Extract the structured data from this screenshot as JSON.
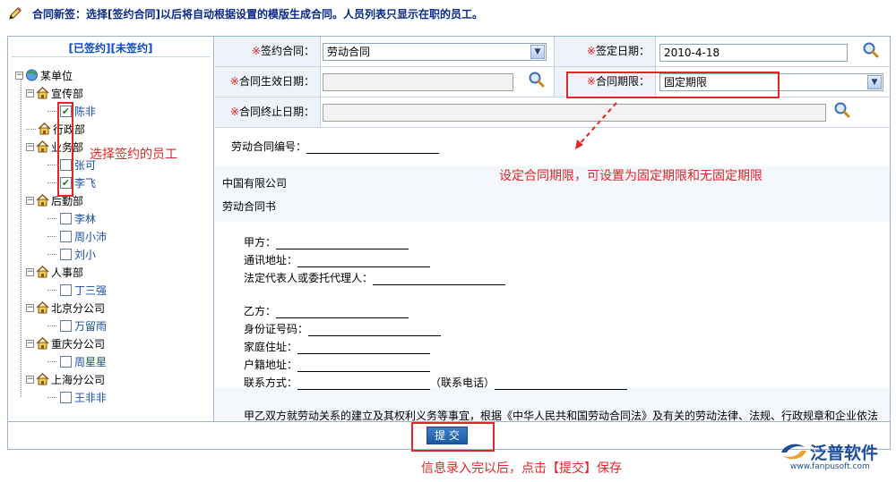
{
  "header": {
    "notice": "合同新签：选择[签约合同]以后将自动根据设置的模版生成合同。人员列表只显示在职的员工。",
    "pen_icon": "pencil-icon"
  },
  "tree": {
    "tab_signed": "[已签约]",
    "tab_unsigned": "[未签约]",
    "root": "某单位",
    "nodes": [
      {
        "dept": "宣传部",
        "employees": [
          {
            "name": "陈非",
            "checked": true
          }
        ]
      },
      {
        "dept": "行政部",
        "employees": []
      },
      {
        "dept": "业务部",
        "employees": [
          {
            "name": "张可",
            "checked": false
          },
          {
            "name": "李飞",
            "checked": true
          }
        ]
      },
      {
        "dept": "后勤部",
        "employees": [
          {
            "name": "李林",
            "checked": false
          },
          {
            "name": "周小沛",
            "checked": false
          },
          {
            "name": "刘小",
            "checked": false
          }
        ]
      },
      {
        "dept": "人事部",
        "employees": [
          {
            "name": "丁三强",
            "checked": false
          }
        ]
      },
      {
        "dept": "北京分公司",
        "employees": [
          {
            "name": "万留雨",
            "checked": false
          }
        ]
      },
      {
        "dept": "重庆分公司",
        "employees": [
          {
            "name": "周星星",
            "checked": false
          }
        ]
      },
      {
        "dept": "上海分公司",
        "employees": [
          {
            "name": "王非非",
            "checked": false
          }
        ]
      }
    ]
  },
  "form": {
    "contract_label": "签约合同：",
    "contract_value": "劳动合同",
    "sign_date_label": "签定日期：",
    "sign_date_value": "2010-4-18",
    "effective_date_label": "合同生效日期：",
    "effective_date_value": "",
    "term_label": "合同期限：",
    "term_value": "固定期限",
    "end_date_label": "合同终止日期：",
    "end_date_value": "",
    "required_mark": "※"
  },
  "document": {
    "contract_no": "劳动合同编号：",
    "company": "中国有限公司",
    "title": "劳动合同书",
    "party_a": "甲方：",
    "address": "通讯地址：",
    "legal_rep": "法定代表人或委托代理人：",
    "party_b": "乙方：",
    "id_no": "身份证号码：",
    "home_addr": "家庭住址：",
    "household_addr": "户籍地址：",
    "contact": "联系方式：",
    "contact_phone": "（联系电话）",
    "clause": "甲乙双方就劳动关系的建立及其权利义务等事宜，根据《中华人民共和国劳动合同法》及有关的劳动法律、法规、行政规章和企业依法"
  },
  "actions": {
    "submit_label": "提 交"
  },
  "annotations": {
    "select_employee": "选择签约的员工",
    "term_hint": "设定合同期限，可设置为固定期限和无固定期限",
    "submit_hint": "信息录入完以后，点击【提交】保存"
  },
  "brand": {
    "name": "泛普软件",
    "url": "www.fanpusoft.com"
  },
  "colors": {
    "accent": "#0a2a8a",
    "annotation": "#e42525",
    "link": "#1a4fa3"
  }
}
